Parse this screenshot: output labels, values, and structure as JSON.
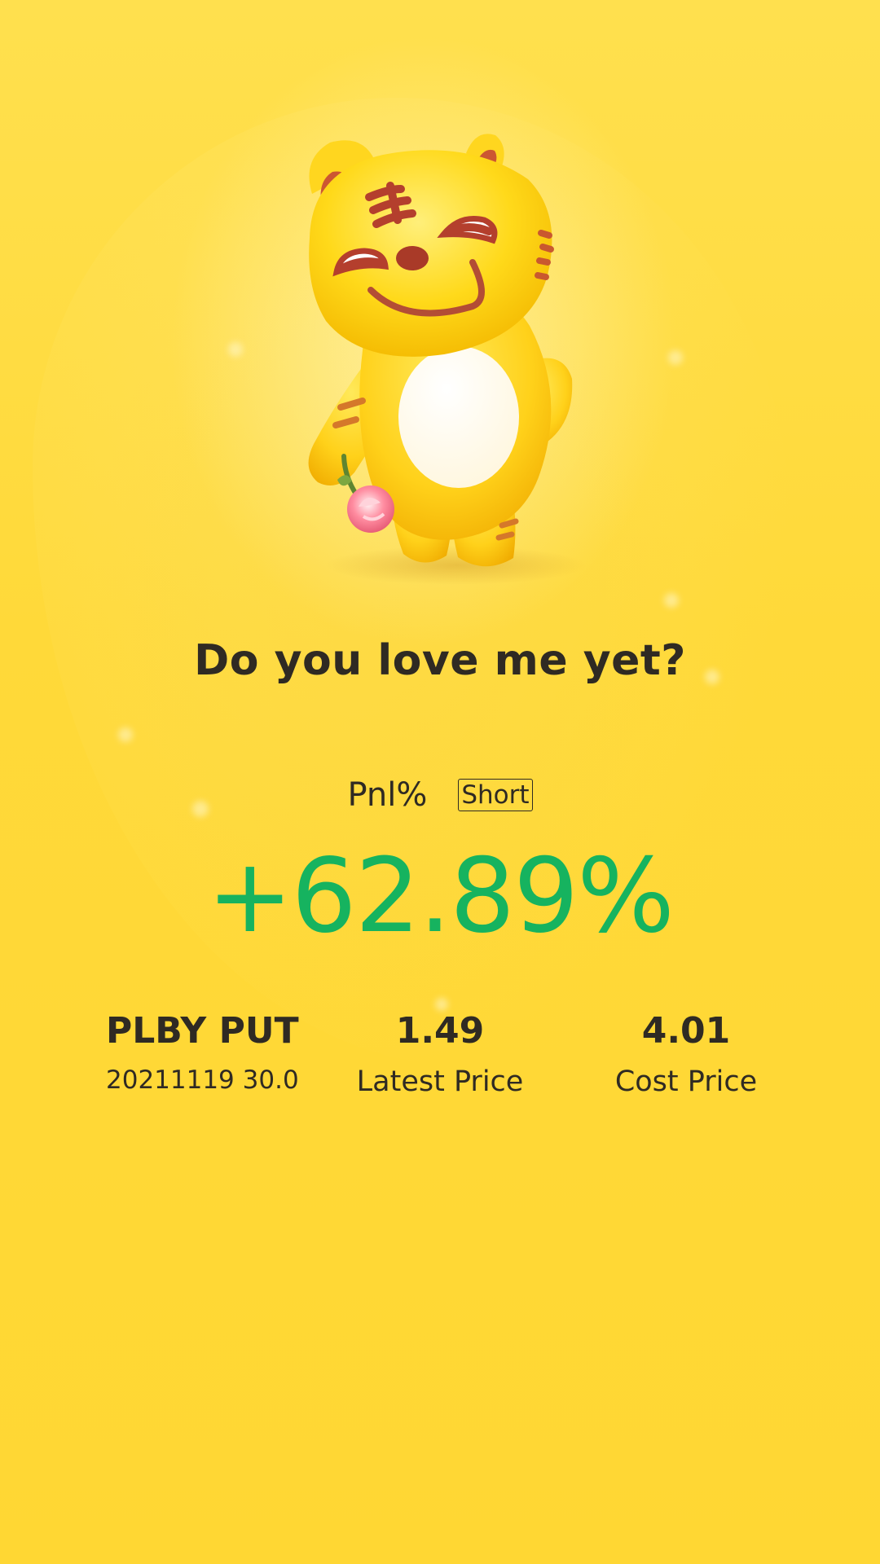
{
  "headline": "Do you love me yet?",
  "pnl": {
    "label": "Pnl%",
    "position_tag": "Short",
    "value": "+62.89%",
    "color": "#16b35f"
  },
  "position": {
    "ticker": "PLBY PUT",
    "contract": "20211119 30.0"
  },
  "latest_price": {
    "value": "1.49",
    "label": "Latest Price"
  },
  "cost_price": {
    "value": "4.01",
    "label": "Cost Price"
  },
  "colors": {
    "background": "#ffd733",
    "mascot": "#ffd81d",
    "positive": "#16b35f",
    "text": "#2f2a23"
  },
  "mascot": {
    "icon": "tiger-mascot-icon"
  }
}
